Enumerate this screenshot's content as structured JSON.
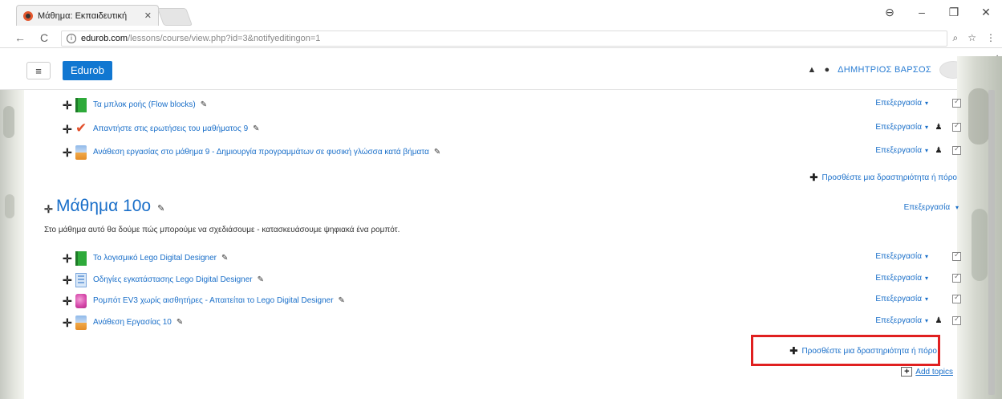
{
  "browser": {
    "tab_title": "Μάθημα: Εκπαιδευτική",
    "tab_close": "✕",
    "url_host": "edurob.com",
    "url_path": "/lessons/course/view.php?id=3&notifyeditingon=1",
    "back": "←",
    "reload": "C",
    "info": "i",
    "zoom": "⌕",
    "star": "☆",
    "menu": "⋮",
    "account": "⊖",
    "minimize": "–",
    "restore": "❐",
    "close": "✕"
  },
  "navbar": {
    "menu_glyph": "≡",
    "brand": "Edurob",
    "bell": "🔔",
    "chat": "💬",
    "user_name": "ΔΗΜΗΤΡΙΟΣ ΒΑΡΣΟΣ",
    "caret": "▾"
  },
  "common": {
    "move": "✛",
    "pencil": "✎",
    "edit_label": "Επεξεργασία",
    "edit_caret": "▾",
    "person": "♟",
    "add_activity_plus": "✚"
  },
  "section_prev": {
    "activities": [
      {
        "icon": "book-icon",
        "name": "Τα μπλοκ ροής (Flow blocks)",
        "restricted": false
      },
      {
        "icon": "quiz-icon",
        "name": "Απαντήστε στις ερωτήσεις του μαθήματος 9",
        "restricted": true
      },
      {
        "icon": "assignment-icon",
        "name": "Ανάθεση εργασίας στο μάθημα 9 - Δημιουργία προγραμμάτων σε φυσική γλώσσα κατά βήματα",
        "restricted": true
      }
    ],
    "add_activity": "Προσθέστε μια δραστηριότητα ή πόρο"
  },
  "section_10": {
    "title": "Μάθημα 10ο",
    "edit_label": "Επεξεργασία",
    "summary": "Στο μάθημα αυτό θα δούμε πώς μπορούμε να σχεδιάσουμε - κατασκευάσουμε ψηφιακά ένα ρομπότ.",
    "activities": [
      {
        "icon": "book-icon",
        "name": "Το λογισμικό Lego Digital Designer",
        "restricted": false
      },
      {
        "icon": "page-icon",
        "name": "Οδηγίες εγκατάστασης Lego Digital Designer",
        "restricted": false
      },
      {
        "icon": "url-icon",
        "name": "Ρομπότ EV3 χωρίς αισθητήρες - Απαιτείται το Lego Digital Designer",
        "restricted": false
      },
      {
        "icon": "assignment-icon",
        "name": "Ανάθεση Εργασίας 10",
        "restricted": true
      }
    ],
    "add_activity": "Προσθέστε μια δραστηριότητα ή πόρο"
  },
  "add_topics": {
    "plus": "+",
    "label": "Add topics"
  }
}
